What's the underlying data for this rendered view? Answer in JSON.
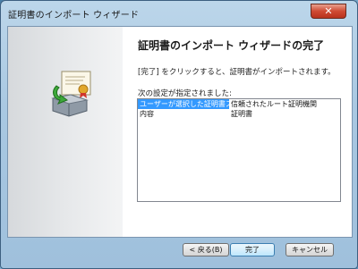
{
  "window": {
    "title": "証明書のインポート ウィザード",
    "close_glyph": "✕"
  },
  "wizard": {
    "heading": "証明書のインポート ウィザードの完了",
    "instruction": "[完了] をクリックすると、証明書がインポートされます。",
    "settings_label": "次の設定が指定されました:",
    "settings": [
      {
        "key": "ユーザーが選択した証明書ストア",
        "value": "信頼されたルート証明機関"
      },
      {
        "key": "内容",
        "value": "証明書"
      }
    ]
  },
  "buttons": {
    "back": "< 戻る(B)",
    "finish": "完了",
    "cancel": "キャンセル"
  },
  "icons": {
    "wizard": "certificate-install-icon",
    "close": "close-icon"
  },
  "colors": {
    "selection": "#3399ff",
    "close_button": "#cf4a33"
  }
}
